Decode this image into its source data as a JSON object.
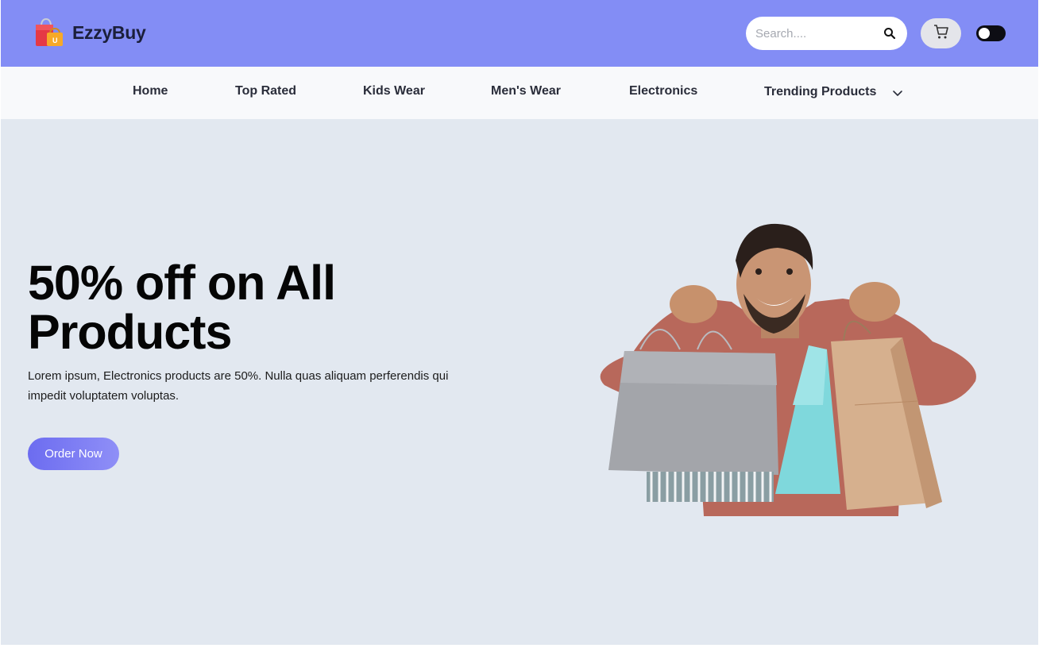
{
  "brand": {
    "name": "EzzyBuy",
    "color": "#838df5"
  },
  "search": {
    "placeholder": "Search...."
  },
  "icons": {
    "logo": "shopping-bag-icon",
    "search": "search-icon",
    "cart": "cart-icon",
    "theme_toggle": "dark-mode-toggle",
    "dropdown": "chevron-down-icon"
  },
  "nav": {
    "items": [
      {
        "label": "Home"
      },
      {
        "label": "Top Rated"
      },
      {
        "label": "Kids Wear"
      },
      {
        "label": "Men's Wear"
      },
      {
        "label": "Electronics"
      },
      {
        "label": "Trending Products"
      }
    ]
  },
  "hero": {
    "title": "50% off on All Products",
    "description": "Lorem ipsum, Electronics products are 50%. Nulla quas aliquam perferendis qui impedit voluptatem voluptas.",
    "cta_label": "Order Now",
    "image": "man-holding-shopping-bags"
  },
  "colors": {
    "hero_bg": "#e2e8f0",
    "nav_bg": "#f8f9fb",
    "cta": "#6c6cf0"
  }
}
